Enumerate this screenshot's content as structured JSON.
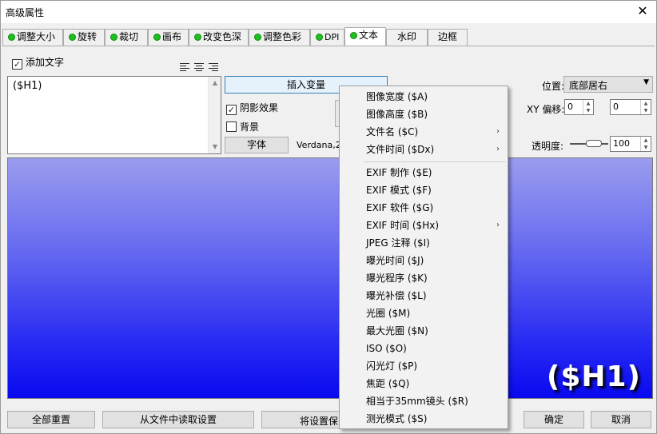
{
  "window": {
    "title": "高级属性"
  },
  "tabs": [
    {
      "label": "调整大小",
      "dot": true
    },
    {
      "label": "旋转",
      "dot": true
    },
    {
      "label": "裁切",
      "dot": true
    },
    {
      "label": "画布",
      "dot": true
    },
    {
      "label": "改变色深",
      "dot": true
    },
    {
      "label": "调整色彩",
      "dot": true
    },
    {
      "label": "DPI",
      "dot": true
    },
    {
      "label": "文本",
      "dot": true
    },
    {
      "label": "水印",
      "dot": false
    },
    {
      "label": "边框",
      "dot": false
    }
  ],
  "text_panel": {
    "add_text_label": "添加文字",
    "add_text_checked": true,
    "text_value": "($H1)",
    "insert_variable_button": "插入变量",
    "shadow_label": "阴影效果",
    "shadow_checked": true,
    "background_label": "背景",
    "background_checked": false,
    "font_button": "字体",
    "font_value": "Verdana,28"
  },
  "position": {
    "label": "位置:",
    "value": "底部居右",
    "xy_label": "XY 偏移:",
    "x": "0",
    "y": "0",
    "opacity_label": "透明度:",
    "opacity": "100"
  },
  "preview": {
    "overlay_text": "($H1)"
  },
  "context_menu": {
    "items": [
      {
        "label": "图像宽度 ($A)",
        "submenu": false
      },
      {
        "label": "图像高度 ($B)",
        "submenu": false
      },
      {
        "label": "文件名 ($C)",
        "submenu": true
      },
      {
        "label": "文件时间 ($Dx)",
        "submenu": true
      },
      {
        "label": "EXIF 制作 ($E)",
        "submenu": false
      },
      {
        "label": "EXIF 模式 ($F)",
        "submenu": false
      },
      {
        "label": "EXIF 软件 ($G)",
        "submenu": false
      },
      {
        "label": "EXIF 时间 ($Hx)",
        "submenu": true
      },
      {
        "label": "JPEG 注释 ($I)",
        "submenu": false
      },
      {
        "label": "曝光时间 ($J)",
        "submenu": false
      },
      {
        "label": "曝光程序 ($K)",
        "submenu": false
      },
      {
        "label": "曝光补偿 ($L)",
        "submenu": false
      },
      {
        "label": "光圈 ($M)",
        "submenu": false
      },
      {
        "label": "最大光圈 ($N)",
        "submenu": false
      },
      {
        "label": "ISO ($O)",
        "submenu": false
      },
      {
        "label": "闪光灯 ($P)",
        "submenu": false
      },
      {
        "label": "焦距 ($Q)",
        "submenu": false
      },
      {
        "label": "相当于35mm镜头 ($R)",
        "submenu": false
      },
      {
        "label": "测光模式 ($S)",
        "submenu": false
      }
    ]
  },
  "footer": {
    "reset_all": "全部重置",
    "load_from_file": "从文件中读取设置",
    "save_settings": "将设置保",
    "ok": "确定",
    "cancel": "取消"
  },
  "colors": {
    "tab_dot": "#1fbf1f",
    "preview_top": "#9a9cee",
    "preview_bottom": "#0909f0"
  }
}
